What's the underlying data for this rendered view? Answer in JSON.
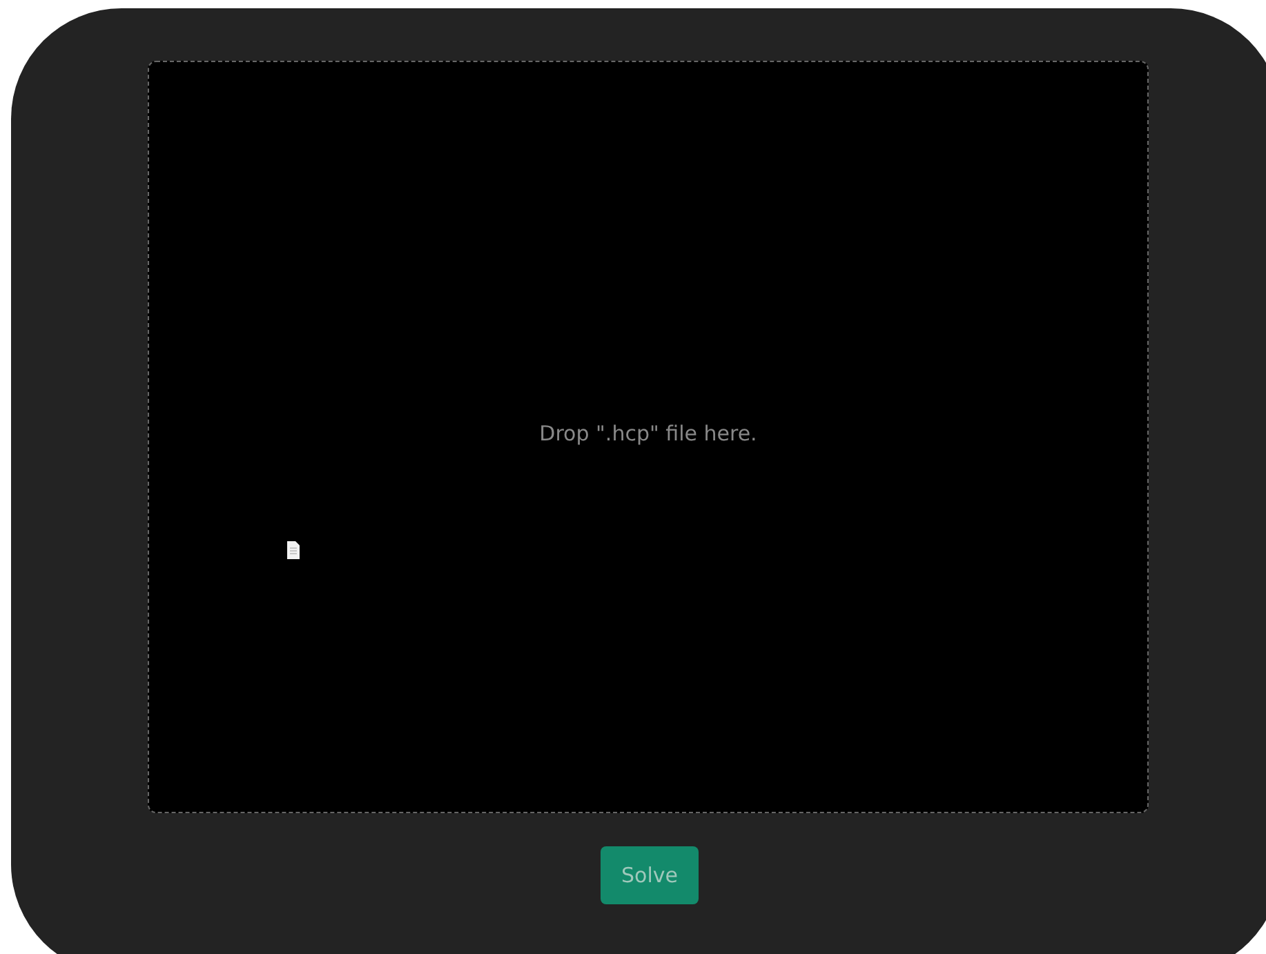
{
  "drop_zone": {
    "message": "Drop \".hcp\" file here."
  },
  "buttons": [
    {
      "label": "Solve"
    }
  ]
}
